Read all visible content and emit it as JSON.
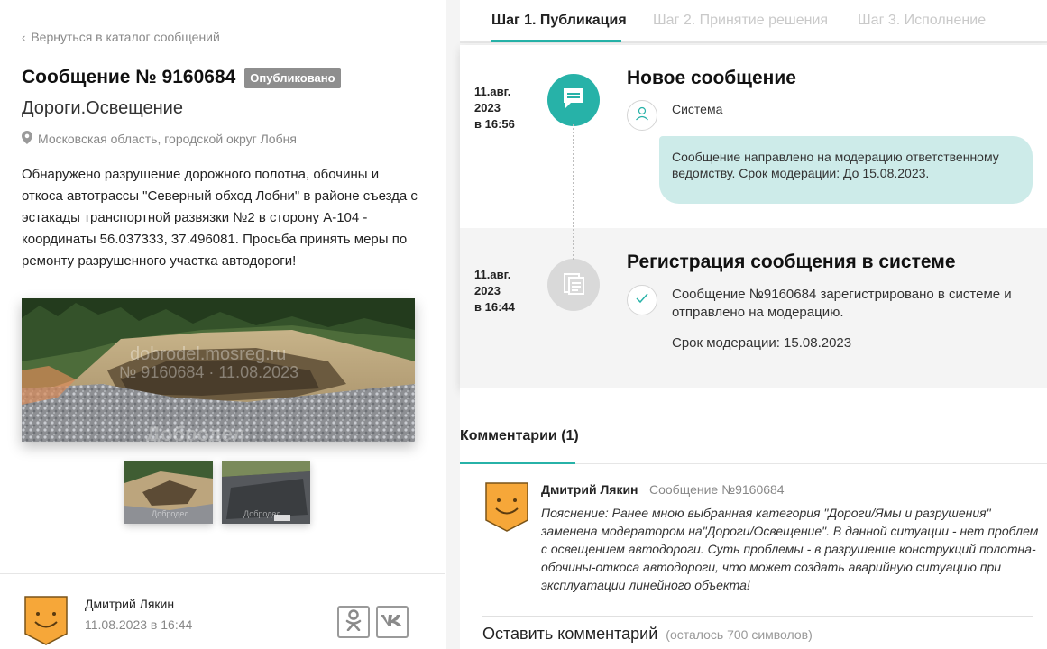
{
  "colors": {
    "accent": "#27b2a8",
    "bubble": "#cdebe9",
    "badge": "#8e8e8e",
    "avatar": "#f6a739",
    "muted_icon": "#d9d9d9"
  },
  "left": {
    "back_link": "Вернуться в каталог сообщений",
    "title": "Сообщение № 9160684",
    "status": "Опубликовано",
    "category": "Дороги.Освещение",
    "location": "Московская область, городской округ Лобня",
    "description": "Обнаружено разрушение дорожного полотна, обочины и откоса автотрассы \"Северный обход Лобни\" в районе съезда с эстакады транспортной развязки №2 в сторону А-104 - координаты 56.037333, 37.496081. Просьба принять меры по ремонту разрушенного участка автодороги!",
    "photo_watermark_1": "dobrodel.mosreg.ru",
    "photo_watermark_2": "№ 9160684 · 11.08.2023",
    "photo_watermark_3": "Добродел",
    "thumb_watermark": "Добродел",
    "author": {
      "name": "Дмитрий Лякин",
      "date": "11.08.2023 в 16:44"
    },
    "share_icons": [
      "odnoklassniki-icon",
      "vk-icon"
    ]
  },
  "right": {
    "tabs": [
      {
        "label": "Шаг 1. Публикация",
        "active": true
      },
      {
        "label": "Шаг 2. Принятие решения",
        "active": false
      },
      {
        "label": "Шаг 3. Исполнение",
        "active": false
      }
    ],
    "events": [
      {
        "date_line1": "11.авг.",
        "date_line2": "2023",
        "date_line3": "в 16:56",
        "title": "Новое сообщение",
        "source": "Система",
        "text": "Сообщение направлено на модерацию ответственному ведомству. Срок модерации: До 15.08.2023.",
        "icon": "chat-bubble-icon"
      },
      {
        "date_line1": "11.авг.",
        "date_line2": "2023",
        "date_line3": "в 16:44",
        "title": "Регистрация сообщения в системе",
        "text": "Сообщение №9160684 зарегистрировано в системе и отправлено на модерацию.",
        "deadline": "Срок модерации: 15.08.2023",
        "icon": "clipboard-icon"
      }
    ],
    "comments": {
      "title": "Комментарии (1)",
      "items": [
        {
          "author": "Дмитрий Лякин",
          "ref": "Сообщение №9160684",
          "text": "Пояснение: Ранее мною выбранная категория \"Дороги/Ямы и разрушения\" заменена модератором на\"Дороги/Освещение\". В данной ситуации - нет проблем с освещением автодороги. Суть проблемы - в разрушение конструкций полотна-обочины-откоса автодороги, что может создать аварийную ситуацию при эксплуатации линейного объекта!"
        }
      ],
      "leave_title": "Оставить комментарий",
      "leave_hint": "(осталось 700 символов)"
    }
  }
}
